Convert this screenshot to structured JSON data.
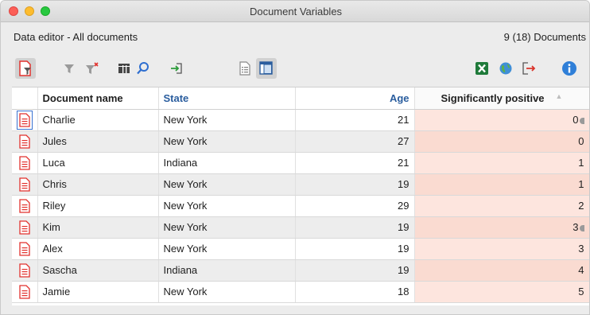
{
  "window": {
    "title": "Document Variables"
  },
  "subheader": {
    "title": "Data editor - All documents",
    "count": "9 (18) Documents"
  },
  "toolbar": {
    "icons": [
      "document-filter-icon",
      "filter-icon",
      "clear-filter-icon",
      "columns-icon",
      "search-icon",
      "import-icon",
      "list-view-icon",
      "detail-view-icon",
      "excel-export-icon",
      "web-export-icon",
      "export-icon",
      "info-icon"
    ],
    "accent_colors": {
      "document": "#e2312d",
      "excel": "#1f7a3a",
      "info": "#2f7fd8",
      "export": "#d9342b"
    }
  },
  "table": {
    "columns": [
      "",
      "Document name",
      "State",
      "Age",
      "Significantly positive"
    ],
    "rows": [
      {
        "name": "Charlie",
        "state": "New York",
        "age": "21",
        "sig": "0",
        "memo": true
      },
      {
        "name": "Jules",
        "state": "New York",
        "age": "27",
        "sig": "0",
        "memo": false
      },
      {
        "name": "Luca",
        "state": "Indiana",
        "age": "21",
        "sig": "1",
        "memo": false
      },
      {
        "name": "Chris",
        "state": "New York",
        "age": "19",
        "sig": "1",
        "memo": false
      },
      {
        "name": "Riley",
        "state": "New York",
        "age": "29",
        "sig": "2",
        "memo": false
      },
      {
        "name": "Kim",
        "state": "New York",
        "age": "19",
        "sig": "3",
        "memo": true
      },
      {
        "name": "Alex",
        "state": "New York",
        "age": "19",
        "sig": "3",
        "memo": false
      },
      {
        "name": "Sascha",
        "state": "Indiana",
        "age": "19",
        "sig": "4",
        "memo": false
      },
      {
        "name": "Jamie",
        "state": "New York",
        "age": "18",
        "sig": "5",
        "memo": false
      }
    ]
  }
}
